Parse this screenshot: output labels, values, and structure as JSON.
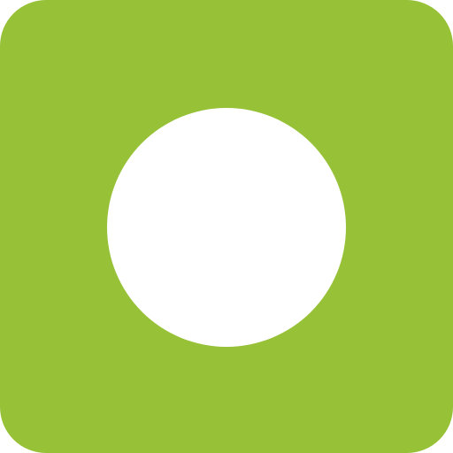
{
  "icon": {
    "name": "circle-icon",
    "colors": {
      "background": "#97c136",
      "dot": "#ffffff"
    }
  }
}
